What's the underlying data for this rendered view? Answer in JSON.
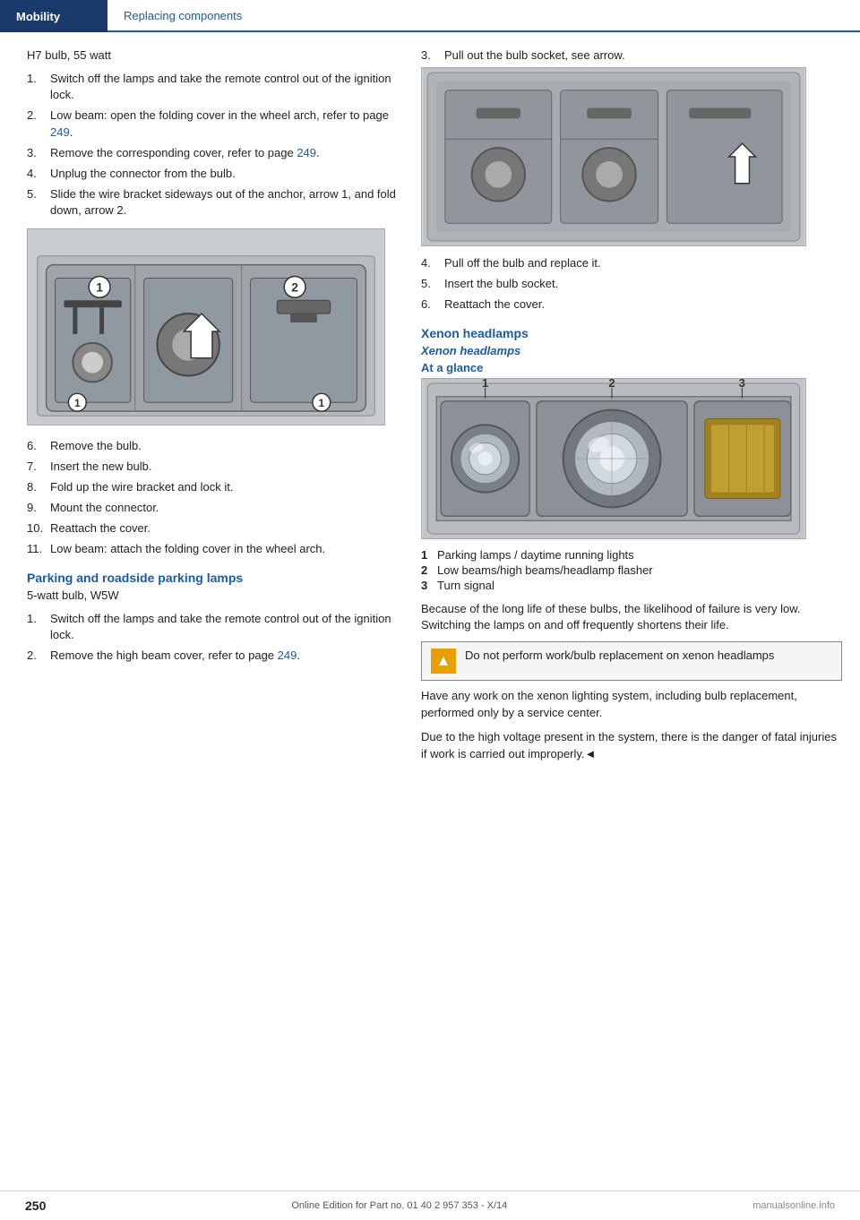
{
  "header": {
    "mobility_label": "Mobility",
    "section_label": "Replacing components"
  },
  "left_column": {
    "intro": "H7 bulb, 55 watt",
    "steps": [
      {
        "num": "1.",
        "text": "Switch off the lamps and take the remote control out of the ignition lock."
      },
      {
        "num": "2.",
        "text": "Low beam: open the folding cover in the wheel arch, refer to page ",
        "link": "249",
        "text_after": "."
      },
      {
        "num": "3.",
        "text": "Remove the corresponding cover, refer to page ",
        "link": "249",
        "text_after": "."
      },
      {
        "num": "4.",
        "text": "Unplug the connector from the bulb."
      },
      {
        "num": "5.",
        "text": "Slide the wire bracket sideways out of the anchor, arrow 1, and fold down, arrow 2."
      },
      {
        "num": "6.",
        "text": "Remove the bulb."
      },
      {
        "num": "7.",
        "text": "Insert the new bulb."
      },
      {
        "num": "8.",
        "text": "Fold up the wire bracket and lock it."
      },
      {
        "num": "9.",
        "text": "Mount the connector."
      },
      {
        "num": "10.",
        "text": "Reattach the cover."
      },
      {
        "num": "11.",
        "text": "Low beam: attach the folding cover in the wheel arch."
      }
    ],
    "parking_section": {
      "heading": "Parking and roadside parking lamps",
      "intro": "5-watt bulb, W5W",
      "steps": [
        {
          "num": "1.",
          "text": "Switch off the lamps and take the remote control out of the ignition lock."
        },
        {
          "num": "2.",
          "text": "Remove the high beam cover, refer to page ",
          "link": "249",
          "text_after": "."
        }
      ]
    }
  },
  "right_column": {
    "step3": {
      "num": "3.",
      "text": "Pull out the bulb socket, see arrow."
    },
    "step4": {
      "num": "4.",
      "text": "Pull off the bulb and replace it."
    },
    "step5": {
      "num": "5.",
      "text": "Insert the bulb socket."
    },
    "step6": {
      "num": "6.",
      "text": "Reattach the cover."
    },
    "xenon_section": {
      "heading": "Xenon headlamps",
      "subheading": "Xenon headlamps",
      "at_glance": "At a glance",
      "legend": [
        {
          "num": "1",
          "text": "Parking lamps / daytime running lights"
        },
        {
          "num": "2",
          "text": "Low beams/high beams/headlamp flasher"
        },
        {
          "num": "3",
          "text": "Turn signal"
        }
      ],
      "body_text_1": "Because of the long life of these bulbs, the likelihood of failure is very low. Switching the lamps on and off frequently shortens their life.",
      "warning": {
        "icon": "!",
        "text": "Do not perform work/bulb replacement on xenon headlamps"
      },
      "body_text_2": "Have any work on the xenon lighting system, including bulb replacement, performed only by a service center.",
      "body_text_3": "Due to the high voltage present in the system, there is the danger of fatal injuries if work is carried out improperly.◄"
    }
  },
  "footer": {
    "page": "250",
    "info": "Online Edition for Part no. 01 40 2 957 353 - X/14",
    "logo": "manualsonline.info"
  }
}
